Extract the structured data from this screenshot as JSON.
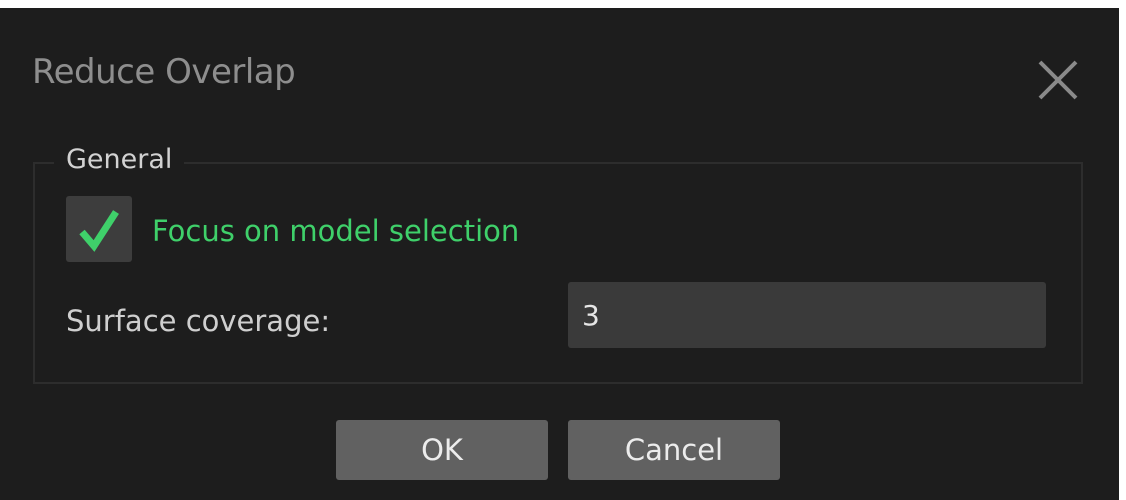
{
  "dialog": {
    "title": "Reduce Overlap",
    "close_icon": "close-icon"
  },
  "group": {
    "legend": "General",
    "checkbox": {
      "label": "Focus on model selection",
      "checked": true,
      "icon": "checkmark-icon",
      "check_color": "#3fd06a"
    },
    "surface_coverage": {
      "label": "Surface coverage:",
      "value": "3"
    }
  },
  "buttons": {
    "ok_label": "OK",
    "cancel_label": "Cancel"
  },
  "colors": {
    "background": "#1d1d1d",
    "accent": "#3fd06a",
    "button": "#616161",
    "input": "#3a3a3a"
  }
}
